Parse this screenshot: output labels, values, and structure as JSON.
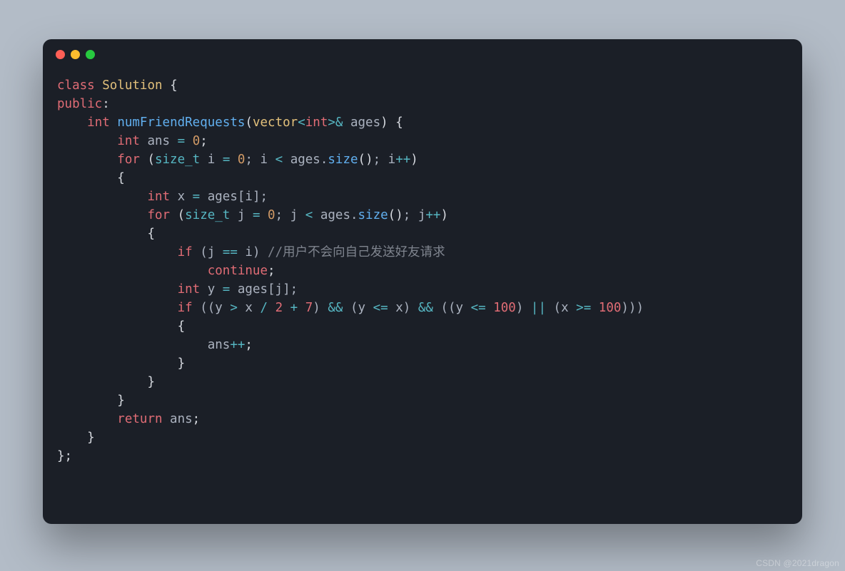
{
  "window": {
    "dots": {
      "red": "#ff5f56",
      "yellow": "#ffbd2e",
      "green": "#27c93f"
    }
  },
  "code": {
    "l1": {
      "kw": "class",
      "type": "Solution",
      "brace": " {"
    },
    "l2": {
      "kw": "public",
      "colon": ":"
    },
    "l3": {
      "indent": "    ",
      "kw": "int",
      "fn": "numFriendRequests",
      "sig1": "(",
      "sig_type": "vector",
      "sig_op": "<",
      "sig_int": "int",
      "sig_op2": ">&",
      "sig_arg": " ages",
      "sig_close": ") {"
    },
    "l4": {
      "indent": "        ",
      "kw": "int",
      "var": " ans ",
      "op": "=",
      "sp": " ",
      "num": "0",
      "semi": ";"
    },
    "l5": {
      "indent": "        ",
      "kw": "for",
      "open": " (",
      "t": "size_t",
      "v": " i ",
      "eq": "=",
      "sp": " ",
      "n0": "0",
      "sep": "; i ",
      "lt": "<",
      "call": " ages.",
      "mfn": "size",
      "paren": "()",
      "sep2": "; i",
      "inc": "++",
      "close": ")"
    },
    "l6": {
      "indent": "        ",
      "brace": "{"
    },
    "l7": {
      "indent": "            ",
      "kw": "int",
      "v": " x ",
      "eq": "=",
      "rhs": " ages[i];"
    },
    "l8": {
      "indent": "            ",
      "kw": "for",
      "open": " (",
      "t": "size_t",
      "v": " j ",
      "eq": "=",
      "sp": " ",
      "n0": "0",
      "sep": "; j ",
      "lt": "<",
      "call": " ages.",
      "mfn": "size",
      "paren": "()",
      "sep2": "; j",
      "inc": "++",
      "close": ")"
    },
    "l9": {
      "indent": "            ",
      "brace": "{"
    },
    "l10": {
      "indent": "                ",
      "kw": "if",
      "open": " (j ",
      "eq": "==",
      "rhs": " i) ",
      "cmt": "//用户不会向自己发送好友请求"
    },
    "l11": {
      "indent": "                    ",
      "kw": "continue",
      "semi": ";"
    },
    "l12": {
      "indent": "                ",
      "kw": "int",
      "v": " y ",
      "eq": "=",
      "rhs": " ages[j];"
    },
    "l13": {
      "indent": "                ",
      "kw": "if",
      "open": " ((y ",
      "gt": ">",
      "mid1": " x ",
      "div": "/",
      "sp1": " ",
      "n2": "2",
      "plus": " + ",
      "n7": "7",
      "mid2": ") ",
      "and1": "&&",
      "mid3": " (y ",
      "le": "<=",
      "mid4": " x) ",
      "and2": "&&",
      "mid5": " ((y ",
      "le2": "<=",
      "sp2": " ",
      "n100a": "100",
      "mid6": ") ",
      "or": "||",
      "mid7": " (x ",
      "ge": ">=",
      "sp3": " ",
      "n100b": "100",
      "mid8": ")))"
    },
    "l14": {
      "indent": "                ",
      "brace": "{"
    },
    "l15": {
      "indent": "                    ",
      "var": "ans",
      "inc": "++",
      "semi": ";"
    },
    "l16": {
      "indent": "                ",
      "brace": "}"
    },
    "l17": {
      "indent": "            ",
      "brace": "}"
    },
    "l18": {
      "indent": "        ",
      "brace": "}"
    },
    "l19": {
      "indent": "        ",
      "kw": "return",
      "v": " ans",
      "semi": ";"
    },
    "l20": {
      "indent": "    ",
      "brace": "}"
    },
    "l21": {
      "brace": "};"
    }
  },
  "watermark": "CSDN @2021dragon"
}
